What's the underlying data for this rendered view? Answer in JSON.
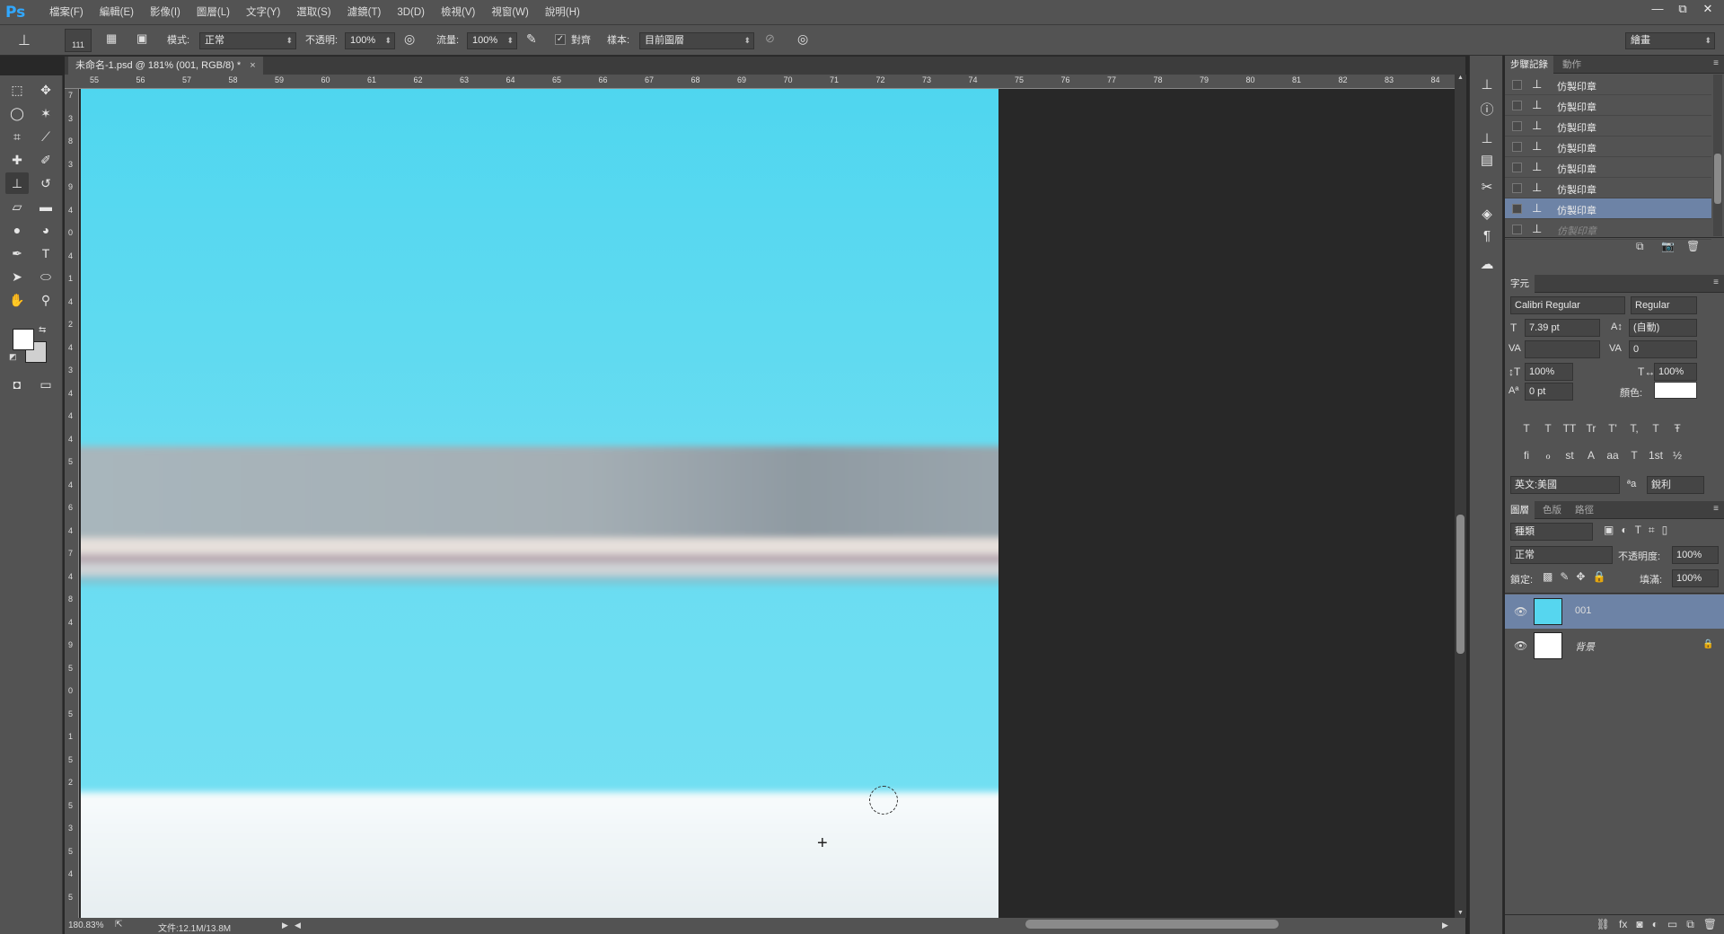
{
  "app": {
    "logo": "Ps",
    "menu": [
      "檔案(F)",
      "編輯(E)",
      "影像(I)",
      "圖層(L)",
      "文字(Y)",
      "選取(S)",
      "濾鏡(T)",
      "3D(D)",
      "檢視(V)",
      "視窗(W)",
      "說明(H)"
    ],
    "window_controls": [
      "—",
      "⧉",
      "✕"
    ]
  },
  "options": {
    "brush_size": "111",
    "mode_label": "模式:",
    "mode_value": "正常",
    "opacity_label": "不透明:",
    "opacity_value": "100%",
    "flow_label": "流量:",
    "flow_value": "100%",
    "aligned_label": "對齊",
    "sample_label": "樣本:",
    "sample_value": "目前圖層",
    "workspace": "繪畫"
  },
  "document": {
    "tab_title": "未命名-1.psd @ 181% (001, RGB/8) *",
    "close": "×"
  },
  "rulers": {
    "h": [
      "55",
      "56",
      "57",
      "58",
      "59",
      "60",
      "61",
      "62",
      "63",
      "64",
      "65",
      "66",
      "67",
      "68",
      "69",
      "70",
      "71",
      "72",
      "73",
      "74",
      "75",
      "76",
      "77",
      "78",
      "79",
      "80",
      "81",
      "82",
      "83",
      "84"
    ],
    "v": [
      "7",
      "3",
      "8",
      "3",
      "9",
      "4",
      "0",
      "4",
      "1",
      "4",
      "2",
      "4",
      "3",
      "4",
      "4",
      "4",
      "5",
      "4",
      "6",
      "4",
      "7",
      "4",
      "8",
      "4",
      "9",
      "5",
      "0",
      "5",
      "1",
      "5",
      "2",
      "5",
      "3",
      "5",
      "4",
      "5"
    ]
  },
  "status": {
    "zoom": "180.83%",
    "file": "文件:12.1M/13.8M"
  },
  "history": {
    "tabs": [
      "步驟記錄",
      "動作"
    ],
    "items": [
      {
        "label": "仿製印章",
        "state": "normal"
      },
      {
        "label": "仿製印章",
        "state": "normal"
      },
      {
        "label": "仿製印章",
        "state": "normal"
      },
      {
        "label": "仿製印章",
        "state": "normal"
      },
      {
        "label": "仿製印章",
        "state": "normal"
      },
      {
        "label": "仿製印章",
        "state": "normal"
      },
      {
        "label": "仿製印章",
        "state": "selected"
      },
      {
        "label": "仿製印章",
        "state": "dimmed"
      }
    ]
  },
  "character": {
    "tab": "字元",
    "font": "Calibri Regular",
    "style": "Regular",
    "size": "7.39 pt",
    "leading": "(自動)",
    "tracking": "0",
    "vscale": "100%",
    "hscale": "100%",
    "baseline": "0 pt",
    "color_label": "顏色:",
    "language": "英文:美國",
    "antialias": "銳利",
    "style_buttons": [
      "T",
      "T",
      "TT",
      "Tr",
      "T'",
      "T,",
      "T",
      "Ŧ"
    ],
    "ot_buttons": [
      "fi",
      "ℴ",
      "st",
      "A",
      "aa",
      "T",
      "1st",
      "½"
    ]
  },
  "layers": {
    "tabs": [
      "圖層",
      "色版",
      "路徑"
    ],
    "filter": "種類",
    "blend": "正常",
    "opacity_label": "不透明度:",
    "opacity": "100%",
    "lock_label": "鎖定:",
    "fill_label": "填滿:",
    "fill": "100%",
    "items": [
      {
        "name": "001",
        "selected": true
      },
      {
        "name": "背景",
        "selected": false
      }
    ],
    "footer_icons": [
      "link-icon",
      "fx-icon",
      "mask-icon",
      "adjustment-icon",
      "folder-icon",
      "new-layer-icon",
      "trash-icon"
    ]
  }
}
